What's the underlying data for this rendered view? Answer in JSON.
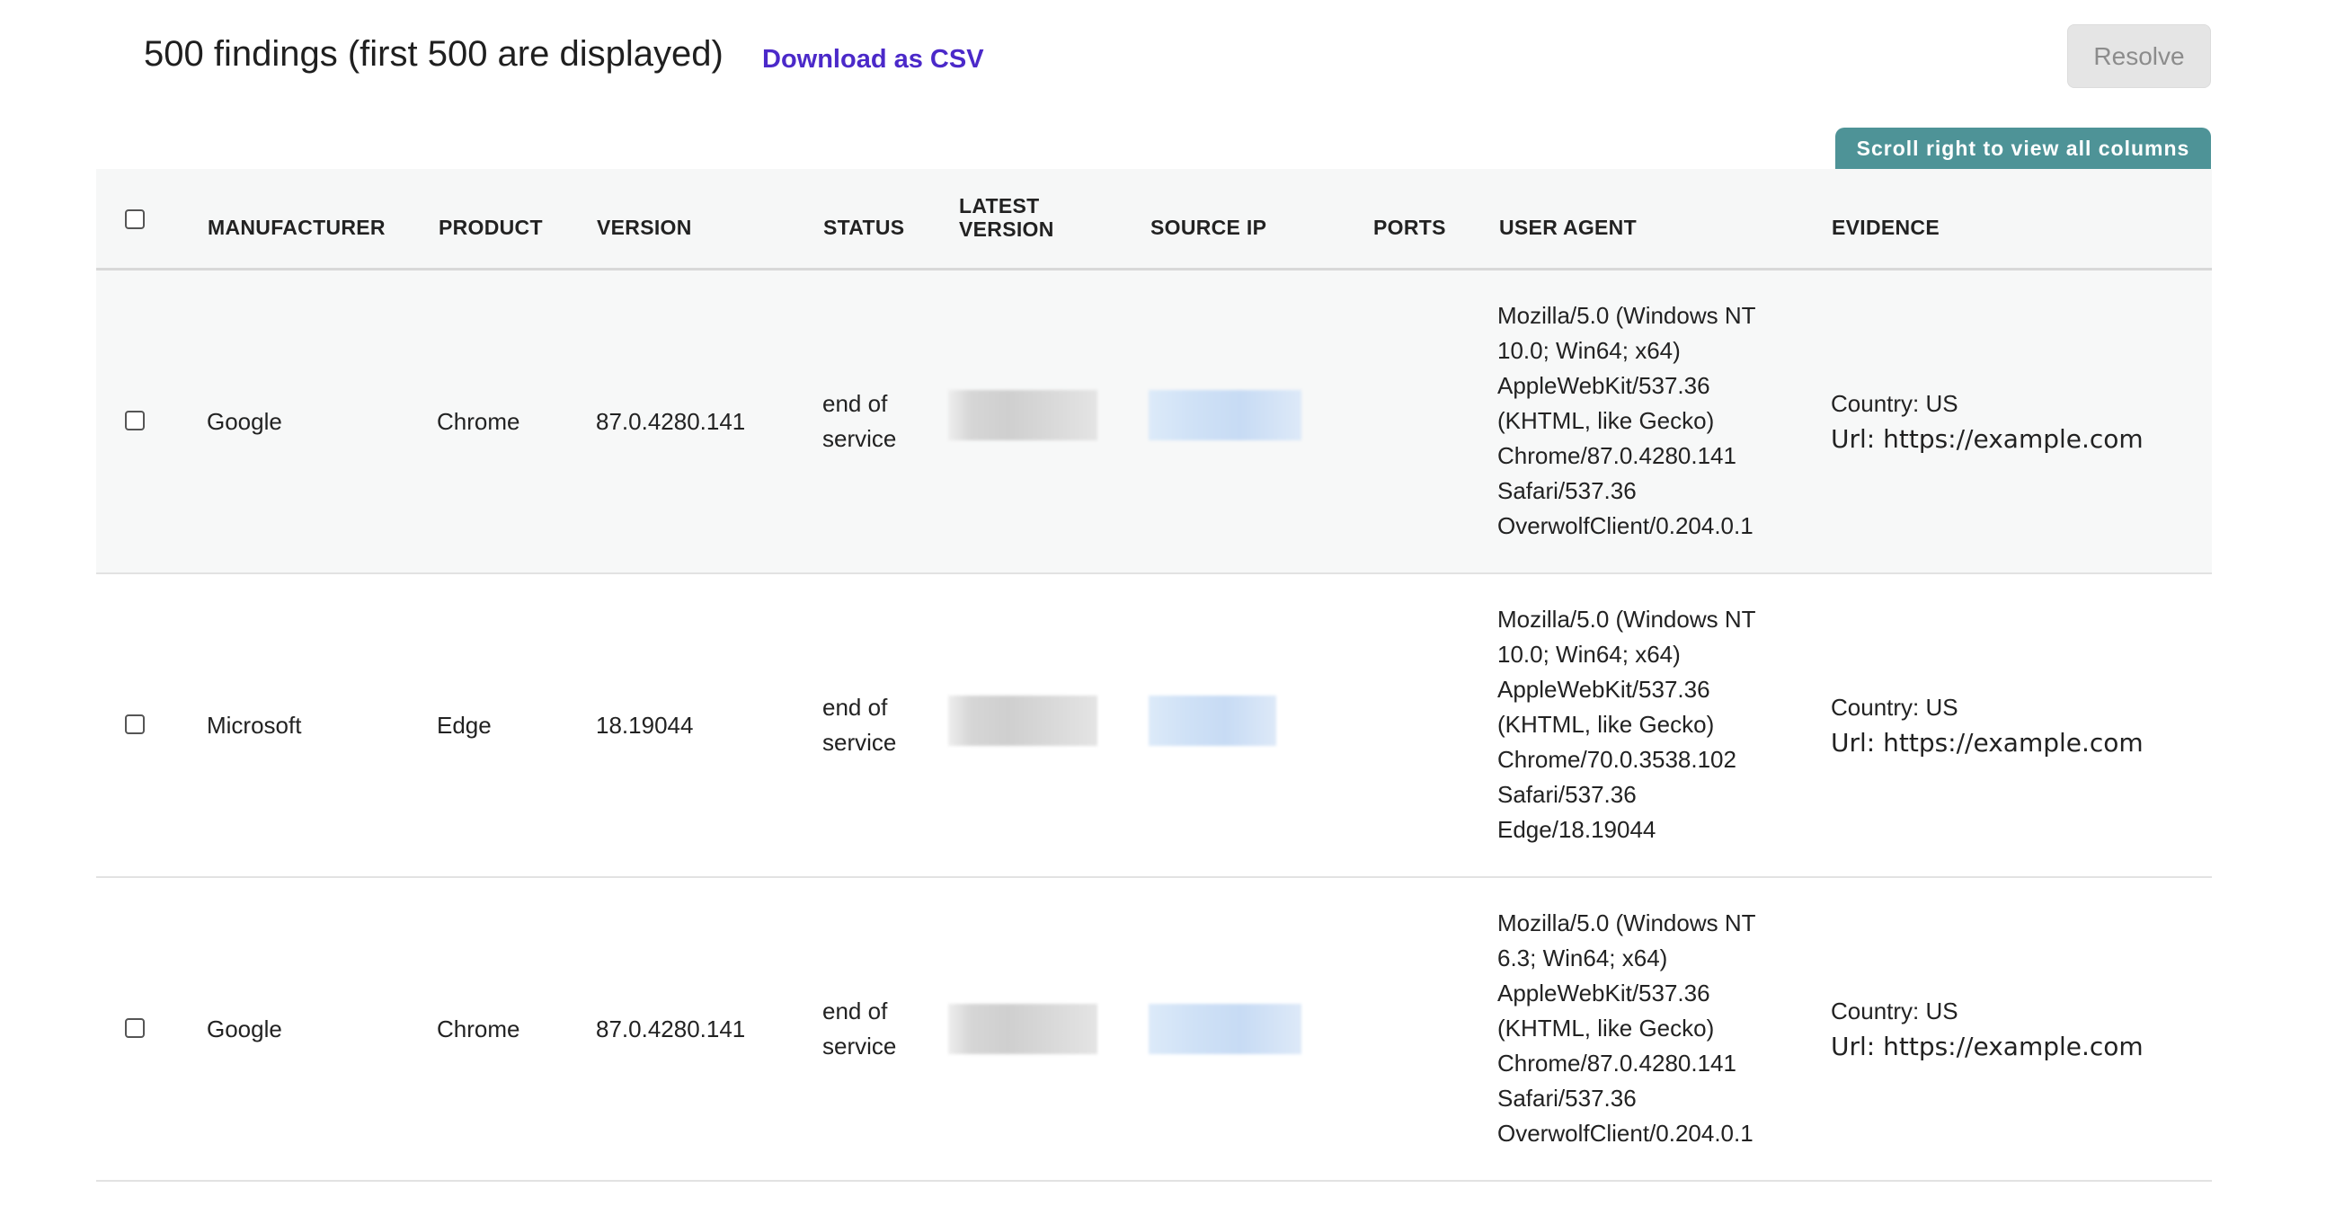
{
  "header": {
    "title": "500 findings (first 500 are displayed)",
    "csv_link": "Download as CSV",
    "resolve_button": "Resolve",
    "scroll_hint": "Scroll right to view all columns"
  },
  "table": {
    "columns": {
      "manufacturer": "MANUFACTURER",
      "product": "PRODUCT",
      "version": "VERSION",
      "status": "STATUS",
      "latest_version_1": "LATEST",
      "latest_version_2": "VERSION",
      "source_ip": "SOURCE IP",
      "ports": "PORTS",
      "user_agent": "USER AGENT",
      "evidence": "EVIDENCE"
    },
    "rows": [
      {
        "manufacturer": "Google",
        "product": "Chrome",
        "version": "87.0.4280.141",
        "status_1": "end of",
        "status_2": "service",
        "ports": "",
        "ua": [
          "Mozilla/5.0 (Windows NT",
          "10.0; Win64; x64)",
          "AppleWebKit/537.36",
          "(KHTML, like Gecko)",
          "Chrome/87.0.4280.141",
          "Safari/537.36",
          "OverwolfClient/0.204.0.1"
        ],
        "evidence_country": "Country: US",
        "evidence_url": "Url: https://example.com"
      },
      {
        "manufacturer": "Microsoft",
        "product": "Edge",
        "version": "18.19044",
        "status_1": "end of",
        "status_2": "service",
        "ports": "",
        "ua": [
          "Mozilla/5.0 (Windows NT",
          "10.0; Win64; x64)",
          "AppleWebKit/537.36",
          "(KHTML, like Gecko)",
          "Chrome/70.0.3538.102",
          "Safari/537.36",
          "Edge/18.19044"
        ],
        "evidence_country": "Country: US",
        "evidence_url": "Url: https://example.com"
      },
      {
        "manufacturer": "Google",
        "product": "Chrome",
        "version": "87.0.4280.141",
        "status_1": "end of",
        "status_2": "service",
        "ports": "",
        "ua": [
          "Mozilla/5.0 (Windows NT",
          "6.3; Win64; x64)",
          "AppleWebKit/537.36",
          "(KHTML, like Gecko)",
          "Chrome/87.0.4280.141",
          "Safari/537.36",
          "OverwolfClient/0.204.0.1"
        ],
        "evidence_country": "Country: US",
        "evidence_url": "Url: https://example.com"
      }
    ]
  },
  "colors": {
    "link": "#4b29c9",
    "scroll_hint_bg": "#4e9397",
    "header_bg": "#f6f7f7",
    "redaction_gray": "#d6d6d6",
    "redaction_blue": "#cfe1f6"
  }
}
